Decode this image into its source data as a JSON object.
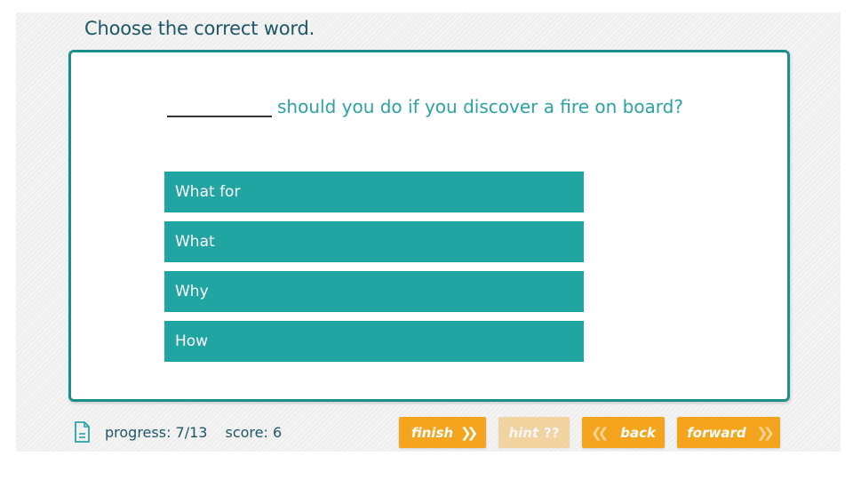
{
  "instruction": "Choose the correct word.",
  "question": {
    "text": "should you do if you discover a fire on board?"
  },
  "answers": [
    {
      "label": "What for"
    },
    {
      "label": "What"
    },
    {
      "label": "Why"
    },
    {
      "label": "How"
    }
  ],
  "footer": {
    "progress_label": "progress: 7/13",
    "score_label": "score: 6",
    "doc_icon": "document-icon"
  },
  "buttons": {
    "finish": "finish",
    "hint": "hint",
    "hint_mark": "??",
    "back": "back",
    "forward": "forward"
  },
  "colors": {
    "accent_teal": "#20a5a3",
    "border_teal": "#1c8f8c",
    "button_orange": "#f4a41d",
    "title_text": "#1d5666"
  }
}
